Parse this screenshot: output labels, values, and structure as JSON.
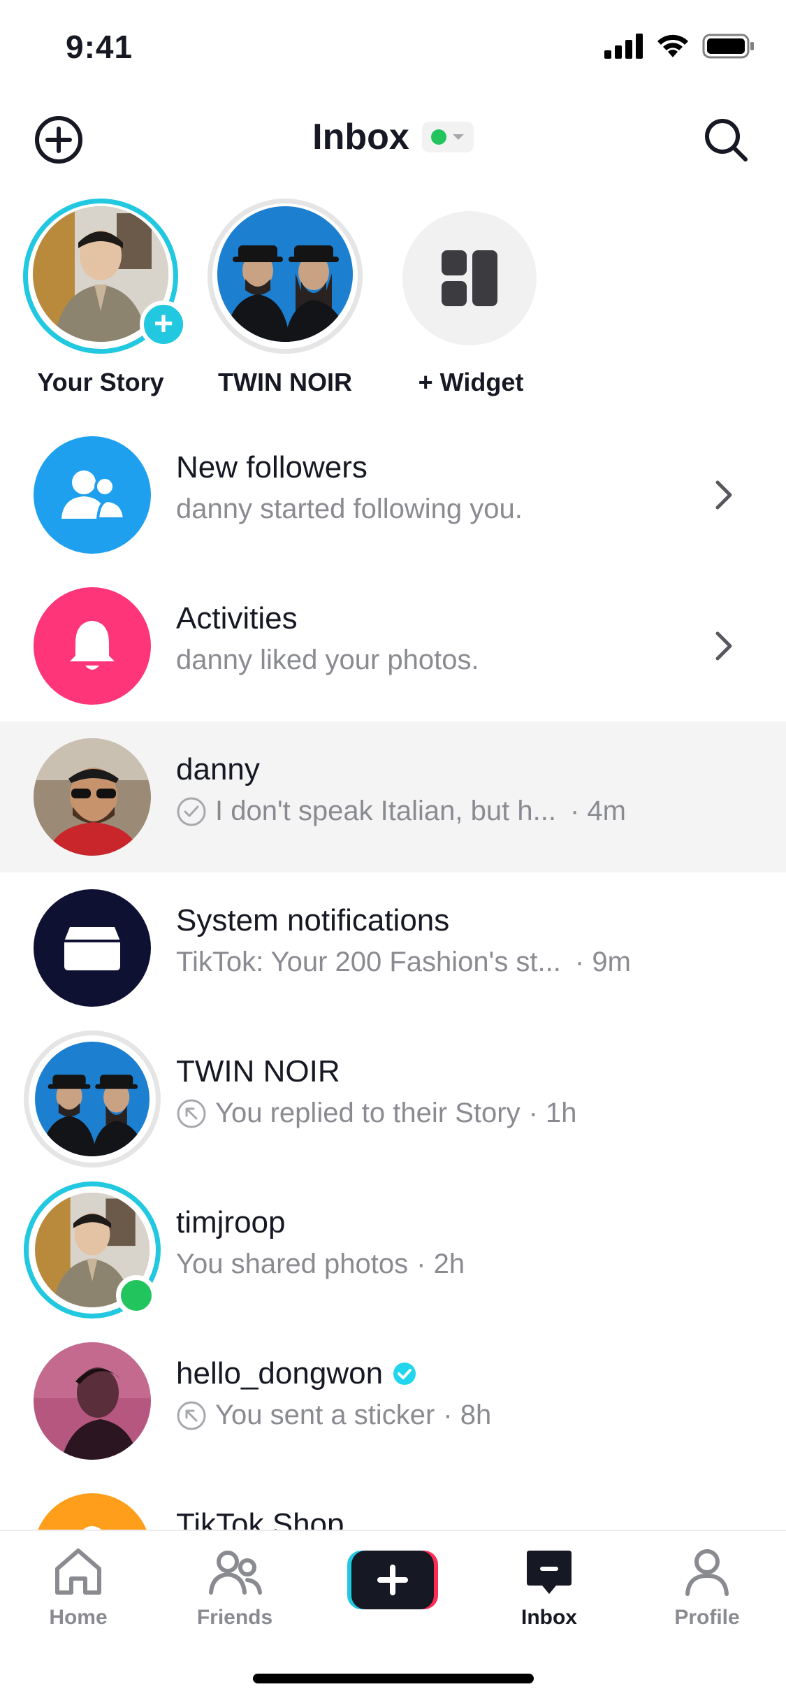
{
  "status_bar": {
    "time": "9:41"
  },
  "header": {
    "title": "Inbox"
  },
  "stories": [
    {
      "label": "Your Story"
    },
    {
      "label": "TWIN NOIR"
    },
    {
      "label": "+ Widget"
    }
  ],
  "rows": [
    {
      "title": "New followers",
      "subtitle": "danny started following you."
    },
    {
      "title": "Activities",
      "subtitle": "danny liked your photos."
    },
    {
      "title": "danny",
      "subtitle": "I don't speak Italian, but h...",
      "time": "· 4m"
    },
    {
      "title": "System notifications",
      "subtitle": "TikTok: Your 200 Fashion's st...",
      "time": "· 9m"
    },
    {
      "title": "TWIN NOIR",
      "subtitle": "You replied to their Story",
      "time": "· 1h"
    },
    {
      "title": "timjroop",
      "subtitle": "You shared photos",
      "time": "· 2h"
    },
    {
      "title": "hello_dongwon",
      "subtitle": "You sent a sticker",
      "time": "· 8h"
    },
    {
      "title": "TikTok Shop"
    }
  ],
  "bottom_nav": {
    "home": "Home",
    "friends": "Friends",
    "inbox": "Inbox",
    "profile": "Profile"
  },
  "colors": {
    "accent_cyan": "#21c8e0",
    "accent_pink": "#fe2c55",
    "online_green": "#21c45d",
    "followers_blue": "#1fa0ef",
    "activities_pink": "#fe3578",
    "system_navy": "#0f1133",
    "shop_orange": "#ff9e1b"
  }
}
